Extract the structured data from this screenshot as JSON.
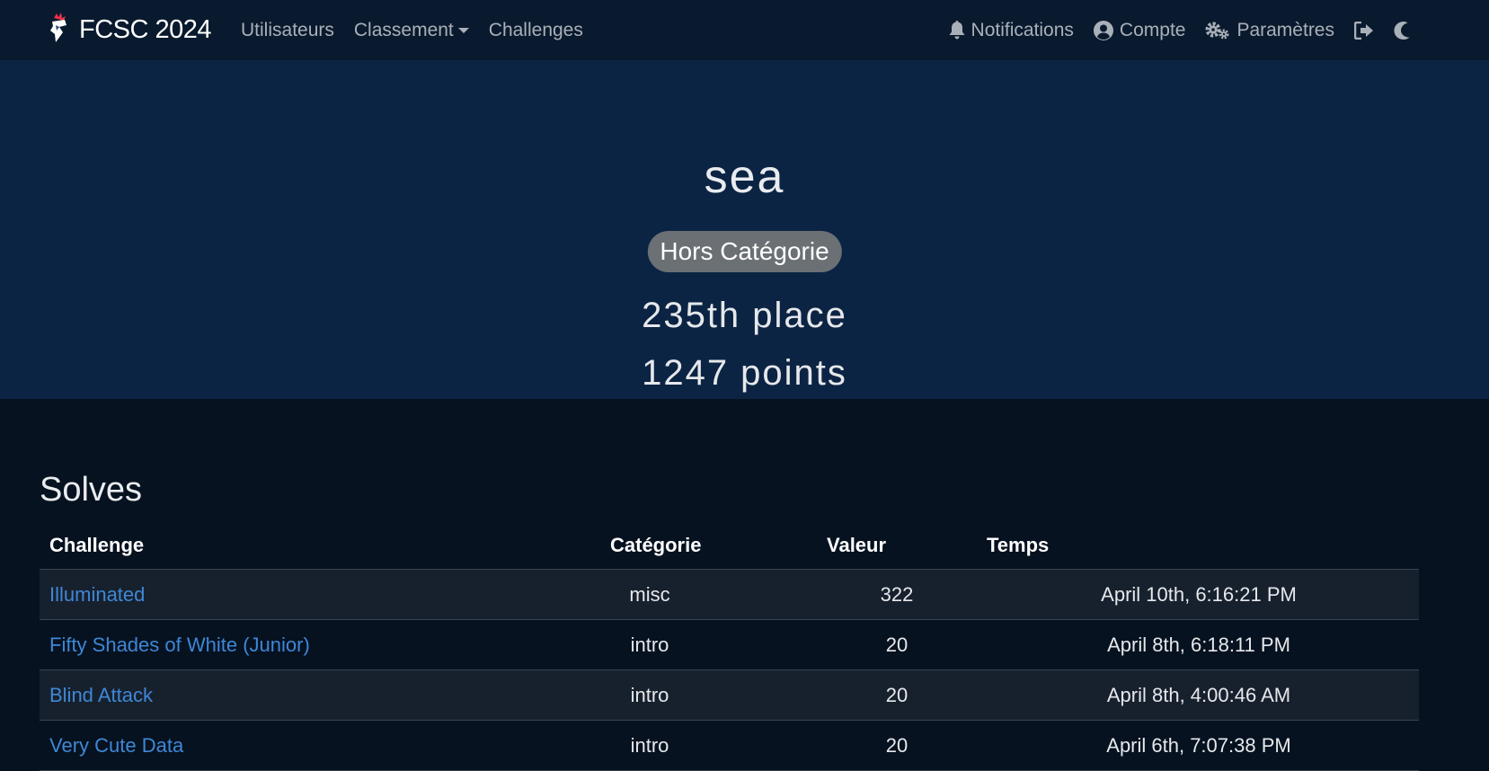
{
  "navbar": {
    "brand": "FCSC 2024",
    "links": {
      "users": "Utilisateurs",
      "scoreboard": "Classement",
      "challenges": "Challenges"
    },
    "right": {
      "notifications": "Notifications",
      "account": "Compte",
      "settings": "Paramètres"
    }
  },
  "profile": {
    "name": "sea",
    "category": "Hors Catégorie",
    "place": "235th place",
    "points": "1247 points"
  },
  "solves": {
    "title": "Solves",
    "headers": {
      "challenge": "Challenge",
      "category": "Catégorie",
      "value": "Valeur",
      "time": "Temps"
    },
    "rows": [
      {
        "challenge": "Illuminated",
        "category": "misc",
        "value": "322",
        "time": "April 10th, 6:16:21 PM"
      },
      {
        "challenge": "Fifty Shades of White (Junior)",
        "category": "intro",
        "value": "20",
        "time": "April 8th, 6:18:11 PM"
      },
      {
        "challenge": "Blind Attack",
        "category": "intro",
        "value": "20",
        "time": "April 8th, 4:00:46 AM"
      },
      {
        "challenge": "Very Cute Data",
        "category": "intro",
        "value": "20",
        "time": "April 6th, 7:07:38 PM"
      }
    ]
  },
  "colors": {
    "navbar_bg": "#0a1a2e",
    "hero_bg": "#0c2444",
    "page_bg": "#061220",
    "link": "#3f87d6",
    "badge_bg": "#6b7075"
  },
  "icons": {
    "brand": "rooster-logo-icon",
    "notifications": "bell-icon",
    "account": "user-circle-icon",
    "settings": "gears-icon",
    "logout": "sign-out-icon",
    "theme": "moon-icon"
  }
}
